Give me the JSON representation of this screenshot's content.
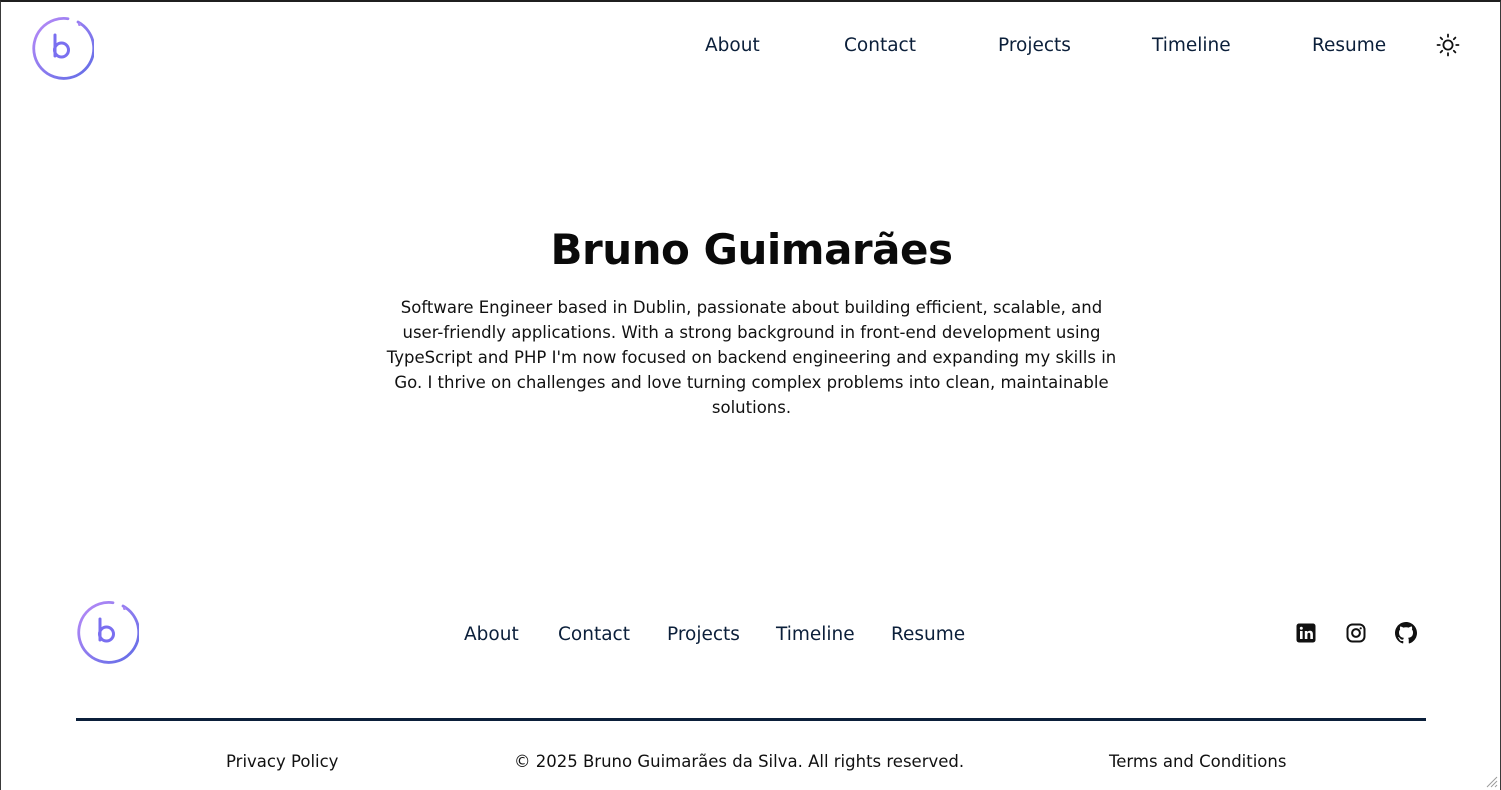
{
  "header": {
    "logo_icon": "b-circle-logo",
    "nav": [
      "About",
      "Contact",
      "Projects",
      "Timeline",
      "Resume"
    ],
    "theme_toggle_icon": "sun-icon"
  },
  "hero": {
    "title": "Bruno Guimarães",
    "description": "Software Engineer based in Dublin, passionate about building efficient, scalable, and user-friendly applications. With a strong background in front-end development using TypeScript and PHP I'm now focused on backend engineering and expanding my skills in Go. I thrive on challenges and love turning complex problems into clean, maintainable solutions."
  },
  "footer": {
    "logo_icon": "b-circle-logo",
    "nav": [
      "About",
      "Contact",
      "Projects",
      "Timeline",
      "Resume"
    ],
    "social_icons": [
      "linkedin-icon",
      "instagram-icon",
      "github-icon"
    ],
    "privacy": "Privacy Policy",
    "copyright": "© 2025 Bruno Guimarães da Silva. All rights reserved.",
    "terms": "Terms and Conditions"
  },
  "colors": {
    "logo_gradient_start": "#b07ef5",
    "logo_gradient_end": "#6a6be8",
    "nav_text": "#0b1f3a",
    "divider": "#0b1f3a"
  }
}
